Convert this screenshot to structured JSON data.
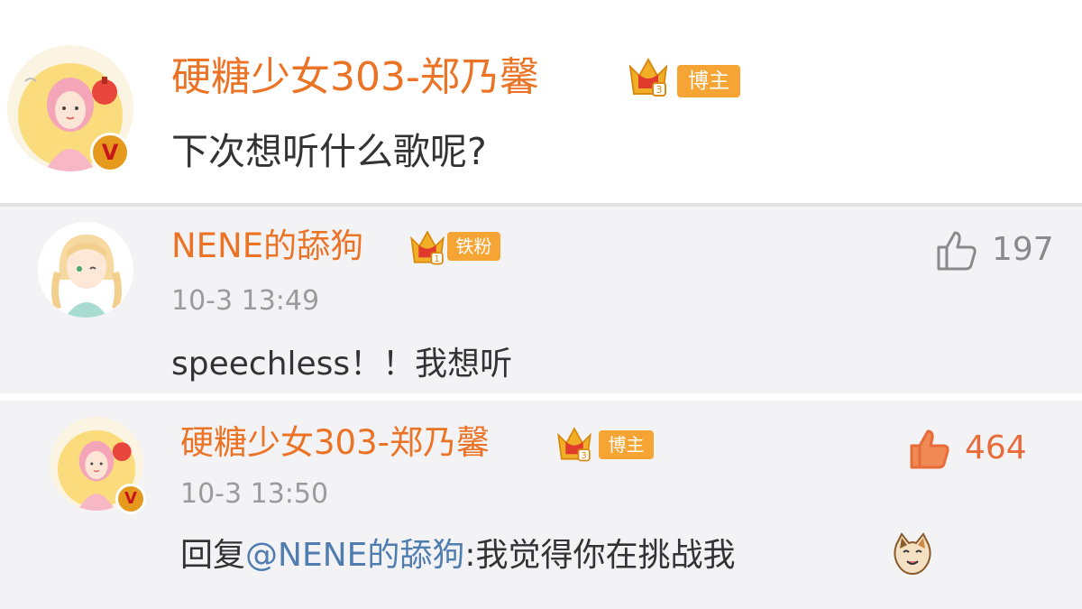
{
  "post": {
    "author": "硬糖少女303-郑乃馨",
    "badge": "博主",
    "text": "下次想听什么歌呢?"
  },
  "comments": [
    {
      "author": "NENE的舔狗",
      "badge": "铁粉",
      "time": "10-3 13:49",
      "text": "speechless！！我想听",
      "likes": "197",
      "liked": false
    },
    {
      "author": "硬糖少女303-郑乃馨",
      "badge": "博主",
      "time": "10-3 13:50",
      "reply_prefix": "回复",
      "mention": "@NENE的舔狗",
      "reply_text": ":我觉得你在挑战我",
      "likes": "464",
      "liked": true
    }
  ],
  "colors": {
    "username": "#eb7325",
    "badge": "#f6a434",
    "mention": "#507daf",
    "liked": "#e86b3a",
    "unliked": "#8a8a8a"
  },
  "icons": [
    "vip-crown-icon",
    "verified-v-icon",
    "like-thumb-icon",
    "cat-emoji-icon"
  ]
}
